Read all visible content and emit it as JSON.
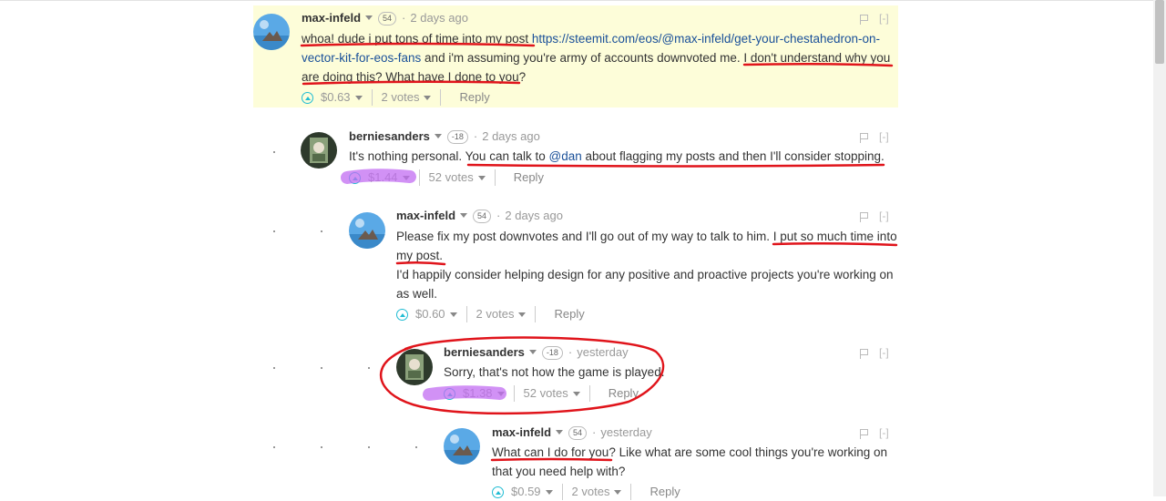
{
  "annotation_colors": {
    "underline": "#e0141b",
    "highlighter": "#c26cf2"
  },
  "comments": [
    {
      "author": "max-infeld",
      "rep": "54",
      "time": "2 days ago",
      "avatar": "mountain-avatar",
      "body": {
        "t1": "whoa! dude i put tons of time into my post ",
        "link": "https://steemit.com/eos/@max-infeld/get-your-chestahedron-on-vector-kit-for-eos-fans",
        "link_line1": "https://steemit.com/eos/@max-infeld/get-your-chestahedron-on-",
        "link_line2": "vector-kit-for-eos-fans",
        "t2": " and i'm assuming you're army of accounts downvoted me. I don't understand why you",
        "t3": "are doing this? What have I done to you?"
      },
      "payout": "$0.63",
      "votes": "2 votes",
      "reply": "Reply"
    },
    {
      "author": "berniesanders",
      "rep": "-18",
      "time": "2 days ago",
      "avatar": "bernie-avatar",
      "body": {
        "t1": "It's nothing personal. You can talk to ",
        "mention": "@dan",
        "t2": " about flagging my posts and then I'll consider stopping."
      },
      "payout": "$1.44",
      "votes": "52 votes",
      "reply": "Reply"
    },
    {
      "author": "max-infeld",
      "rep": "54",
      "time": "2 days ago",
      "avatar": "mountain-avatar",
      "body": {
        "line1": "Please fix my post downvotes and I'll go out of my way to talk to him. I put so much time into",
        "line2": "my post.",
        "line3": "I'd happily consider helping design for any positive and proactive projects you're working on",
        "line4": "as well."
      },
      "payout": "$0.60",
      "votes": "2 votes",
      "reply": "Reply"
    },
    {
      "author": "berniesanders",
      "rep": "-18",
      "time": "yesterday",
      "avatar": "bernie-avatar",
      "body": {
        "line1": "Sorry, that's not how the game is played."
      },
      "payout": "$1.38",
      "votes": "52 votes",
      "reply": "Reply"
    },
    {
      "author": "max-infeld",
      "rep": "54",
      "time": "yesterday",
      "avatar": "mountain-avatar",
      "body": {
        "line1": "What can I do for you? Like what are some cool things you're working on",
        "line2": "that you need help with?"
      },
      "payout": "$0.59",
      "votes": "2 votes",
      "reply": "Reply"
    }
  ],
  "collapse_label": "[-]"
}
